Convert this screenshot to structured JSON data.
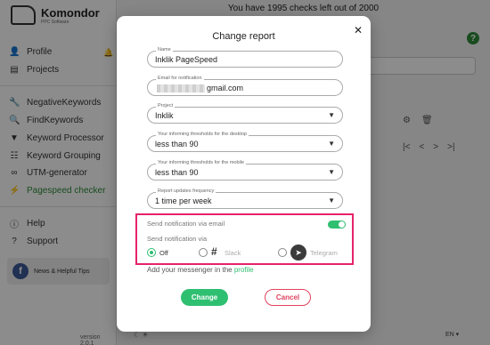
{
  "app": {
    "logo_name": "Komondor",
    "logo_sub": "PPC Software",
    "checks_notice": "You have 1995 checks left out of 2000",
    "version": "version 2.0.1",
    "language": "EN ▾",
    "sidebar": [
      {
        "label": "Profile",
        "icon": "user-icon"
      },
      {
        "label": "Projects",
        "icon": "folder-icon"
      },
      {
        "label": "NegativeKeywords",
        "icon": "wrench-icon"
      },
      {
        "label": "FindKeywords",
        "icon": "search-icon"
      },
      {
        "label": "Keyword Processor",
        "icon": "funnel-icon"
      },
      {
        "label": "Keyword Grouping",
        "icon": "group-icon"
      },
      {
        "label": "UTM-generator",
        "icon": "link-icon"
      },
      {
        "label": "Pagespeed checker",
        "icon": "bolt-icon",
        "active": true
      },
      {
        "label": "Help",
        "icon": "info-icon"
      },
      {
        "label": "Support",
        "icon": "question-icon"
      }
    ],
    "news": "News & Helpful Tips"
  },
  "modal": {
    "title": "Change report",
    "name_label": "Name",
    "name_value": "Inklik PageSpeed",
    "email_label": "Email for notification",
    "email_suffix": "gmail.com",
    "project_label": "Project",
    "project_value": "Inklik",
    "desktop_label": "Your informing thresholds for the desktop",
    "desktop_value": "less than 90",
    "mobile_label": "Your informing thresholds for the mobile",
    "mobile_value": "less than 90",
    "frequency_label": "Report updates frequency",
    "frequency_value": "1 time per week",
    "email_notify_label": "Send notification via email",
    "email_notify_on": true,
    "notify_via_label": "Send notification via",
    "options": [
      {
        "label": "Off",
        "selected": true
      },
      {
        "label": "Slack",
        "selected": false
      },
      {
        "label": "Telegram",
        "selected": false
      }
    ],
    "hint_prefix": "Add your messenger in the",
    "hint_link": "profile",
    "change_label": "Change",
    "cancel_label": "Cancel"
  },
  "colors": {
    "accent": "#2fbf71",
    "highlight": "#e6226b",
    "cancel": "#e0425d"
  }
}
